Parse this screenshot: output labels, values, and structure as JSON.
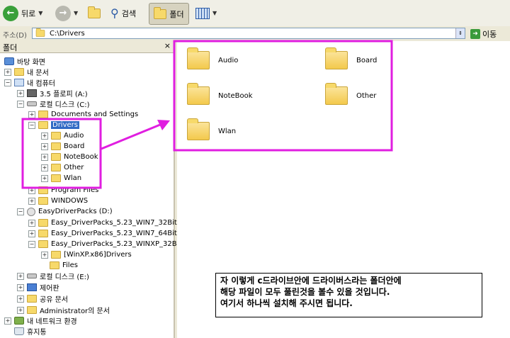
{
  "toolbar": {
    "back_label": "뒤로",
    "search_label": "검색",
    "folders_label": "폴더"
  },
  "address": {
    "label": "주소(D)",
    "value": "C:\\Drivers",
    "go_label": "이동"
  },
  "folders_pane": {
    "title": "폴더",
    "close": "×"
  },
  "tree": {
    "desktop": "바탕 화면",
    "my_documents": "내 문서",
    "my_computer": "내 컴퓨터",
    "floppy": "3.5 플로피 (A:)",
    "local_c": "로컬 디스크 (C:)",
    "docs_settings": "Documents and Settings",
    "drivers": "Drivers",
    "audio": "Audio",
    "board": "Board",
    "notebook": "NoteBook",
    "other": "Other",
    "wlan": "Wlan",
    "program_files": "Program Files",
    "windows": "WINDOWS",
    "easy_d": "EasyDriverPacks (D:)",
    "pack1": "Easy_DriverPacks_5.23_WIN7_32Bit",
    "pack2": "Easy_DriverPacks_5.23_WIN7_64Bit",
    "pack3": "Easy_DriverPacks_5.23_WINXP_32Bit",
    "winxp": "[WinXP.x86]Drivers",
    "files": "Files",
    "local_e": "로컬 디스크 (E:)",
    "control_panel": "제어판",
    "shared_docs": "공유 문서",
    "admin_docs": "Administrator의 문서",
    "network": "내 네트워크 환경",
    "recycle": "휴지통"
  },
  "content": {
    "items": [
      "Audio",
      "Board",
      "NoteBook",
      "Other",
      "Wlan"
    ]
  },
  "note": {
    "line1": "자 이렇게 c드라이브안에 드라이버스라는 폴더안에",
    "line2": "해당 파일이 모두 풀린것을 볼수 있을 것입니다.",
    "line3": "여기서 하나씩 설치해 주시면 됩니다."
  },
  "colors": {
    "highlight": "#e01ee0",
    "selection": "#316ac5"
  }
}
